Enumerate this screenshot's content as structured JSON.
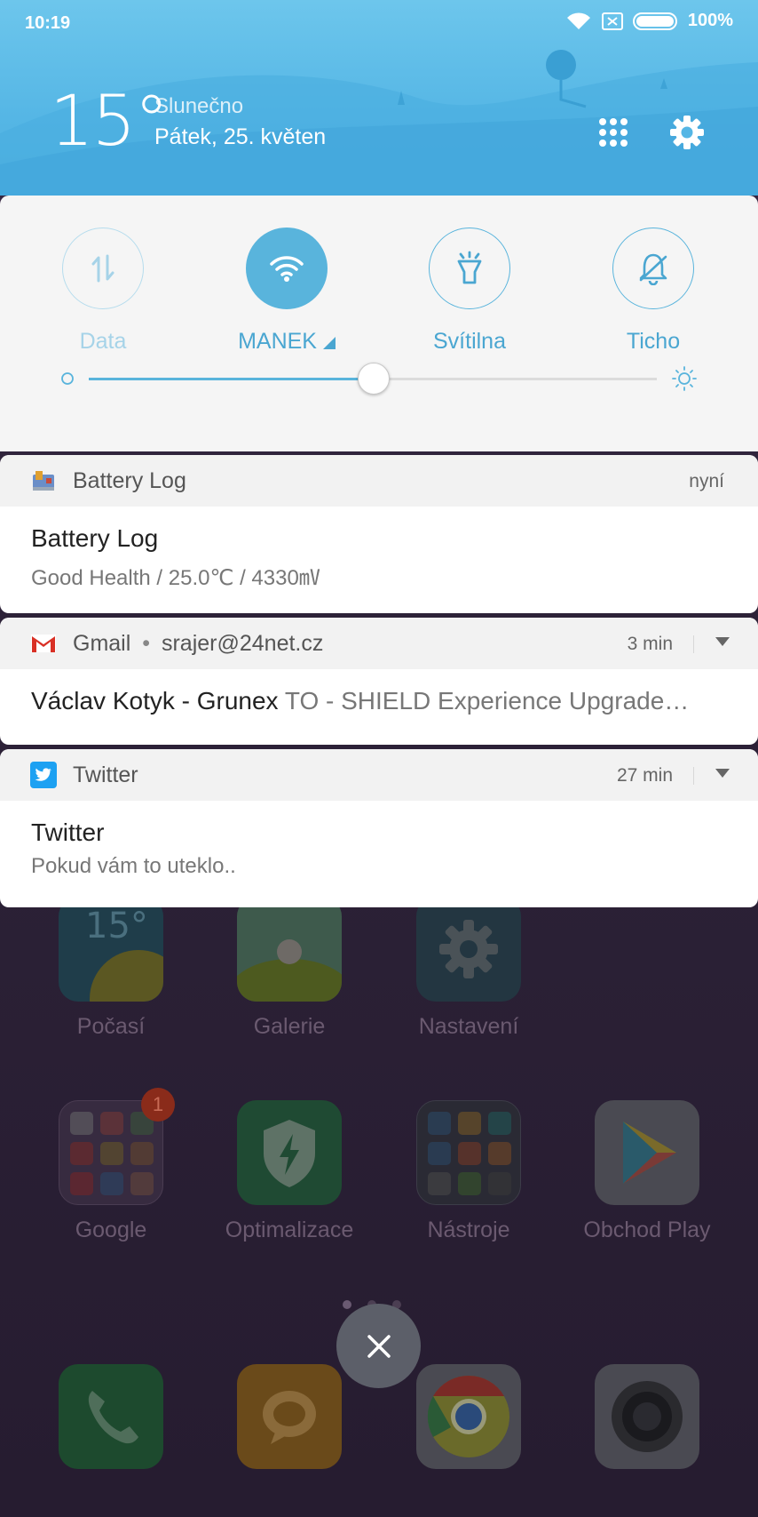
{
  "status_bar": {
    "time": "10:19",
    "battery": "100%"
  },
  "weather": {
    "temperature": "15°",
    "condition": "Slunečno",
    "date": "Pátek, 25. květen"
  },
  "quick_settings": {
    "tiles": [
      {
        "label": "Data",
        "state": "off",
        "icon": "mobile-data-icon"
      },
      {
        "label": "MANEK",
        "state": "on",
        "icon": "wifi-icon"
      },
      {
        "label": "Svítilna",
        "state": "available",
        "icon": "flashlight-icon"
      },
      {
        "label": "Ticho",
        "state": "available",
        "icon": "mute-bell-icon"
      }
    ],
    "brightness_level": 0.5
  },
  "notifications": [
    {
      "app": "Battery Log",
      "time": "nyní",
      "title": "Battery Log",
      "text": "Good Health / 25.0℃ / 4330㎷"
    },
    {
      "app": "Gmail",
      "account": "srajer@24net.cz",
      "time": "3 min",
      "sender": "Václav Kotyk - Grunex",
      "subject": "TO - SHIELD Experience Upgrade…"
    },
    {
      "app": "Twitter",
      "time": "27 min",
      "title": "Twitter",
      "text": "Pokud vám to uteklo.."
    }
  ],
  "home": {
    "row1": [
      "Počasí",
      "Galerie",
      "Nastavení"
    ],
    "row2": [
      "Google",
      "Optimalizace",
      "Nástroje",
      "Obchod Play"
    ],
    "weather_widget_temp": "15°",
    "google_badge": "1"
  },
  "colors": {
    "accent": "#59b4dc",
    "header": "#55b6e5"
  }
}
